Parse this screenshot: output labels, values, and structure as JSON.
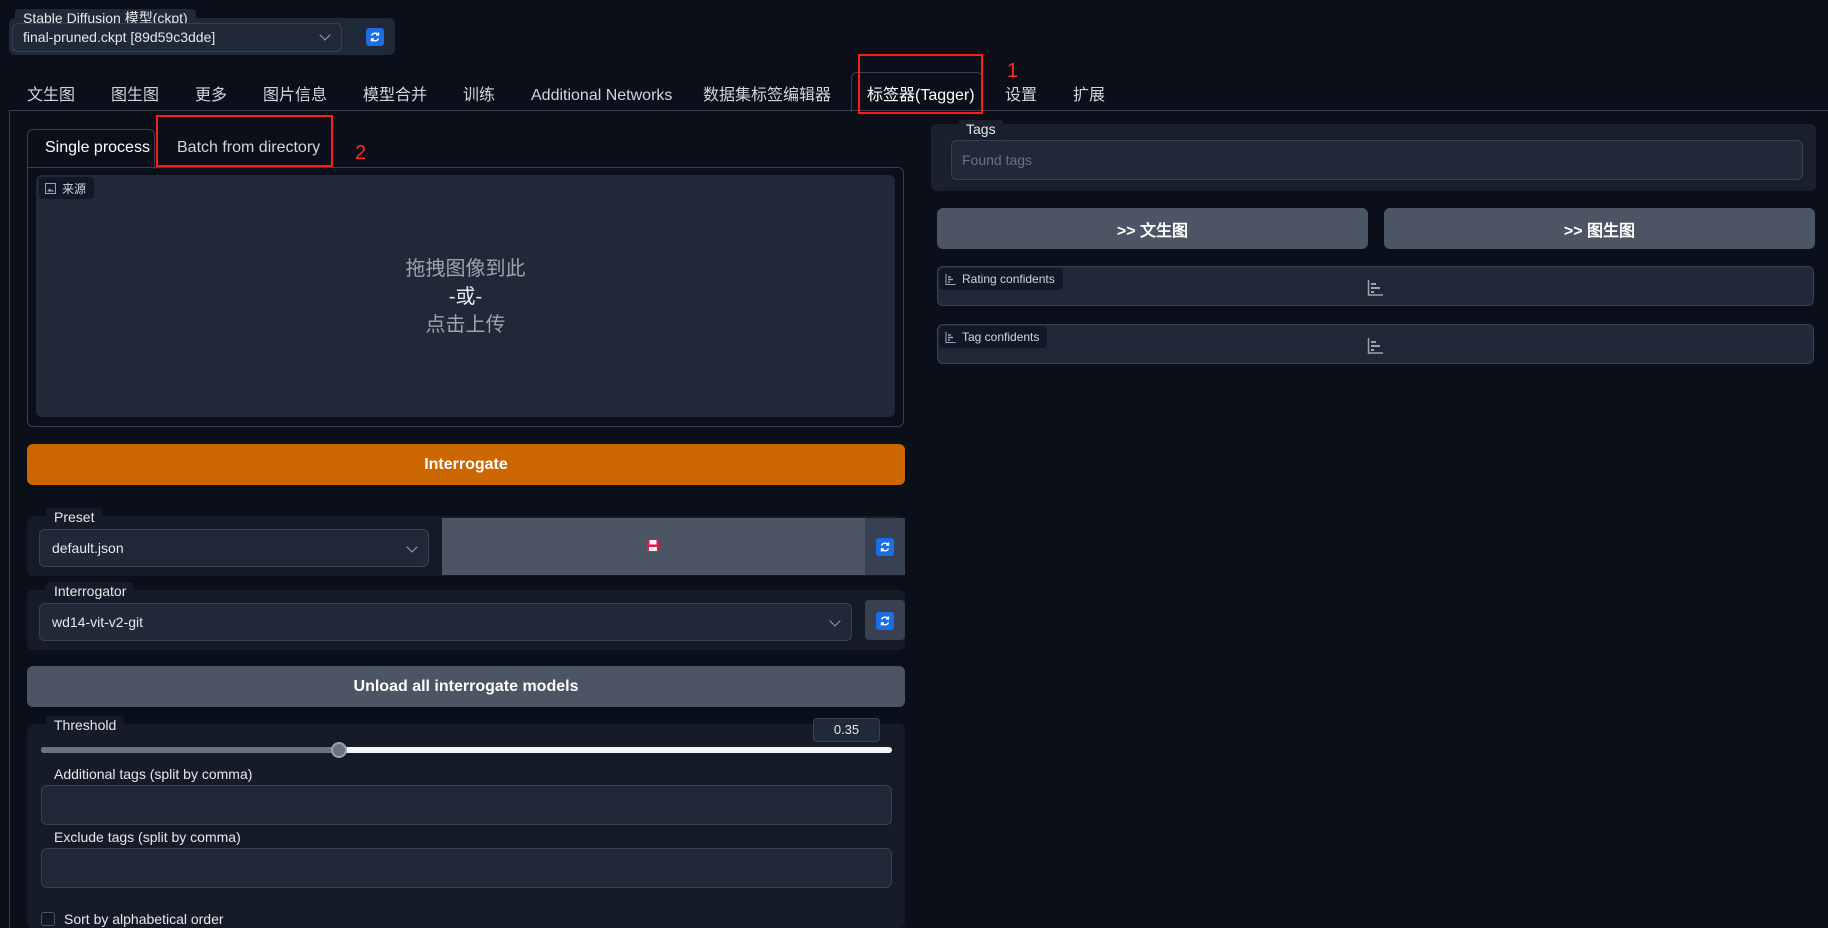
{
  "model": {
    "label": "Stable Diffusion 模型(ckpt)",
    "value": "final-pruned.ckpt [89d59c3dde]"
  },
  "tabs": [
    "文生图",
    "图生图",
    "更多",
    "图片信息",
    "模型合并",
    "训练",
    "Additional Networks",
    "数据集标签编辑器",
    "标签器(Tagger)",
    "设置",
    "扩展"
  ],
  "selected_tab": "标签器(Tagger)",
  "subtabs": {
    "single": "Single process",
    "batch": "Batch from directory"
  },
  "upload": {
    "badge": "来源",
    "line1": "拖拽图像到此",
    "line2": "-或-",
    "line3": "点击上传"
  },
  "buttons": {
    "interrogate": "Interrogate",
    "unload": "Unload all interrogate models",
    "to_txt2img": ">> 文生图",
    "to_img2img": ">> 图生图"
  },
  "preset": {
    "label": "Preset",
    "value": "default.json"
  },
  "interrogator": {
    "label": "Interrogator",
    "value": "wd14-vit-v2-git"
  },
  "threshold": {
    "label": "Threshold",
    "value": 0.35,
    "value_text": "0.35"
  },
  "additional_tags": {
    "label": "Additional tags (split by comma)",
    "value": ""
  },
  "exclude_tags": {
    "label": "Exclude tags (split by comma)",
    "value": ""
  },
  "sort": {
    "label": "Sort by alphabetical order",
    "checked": false
  },
  "tags": {
    "label": "Tags",
    "placeholder": "Found tags"
  },
  "rating_confidents": {
    "label": "Rating confidents"
  },
  "tag_confidents": {
    "label": "Tag confidents"
  },
  "annotations": {
    "marker1": "1",
    "marker2": "2",
    "color": "#ff1a1a"
  },
  "colors": {
    "accent": "#cc6600",
    "background": "#0b0f19",
    "panel": "#1f2937",
    "refresh": "#1d6ee6"
  }
}
